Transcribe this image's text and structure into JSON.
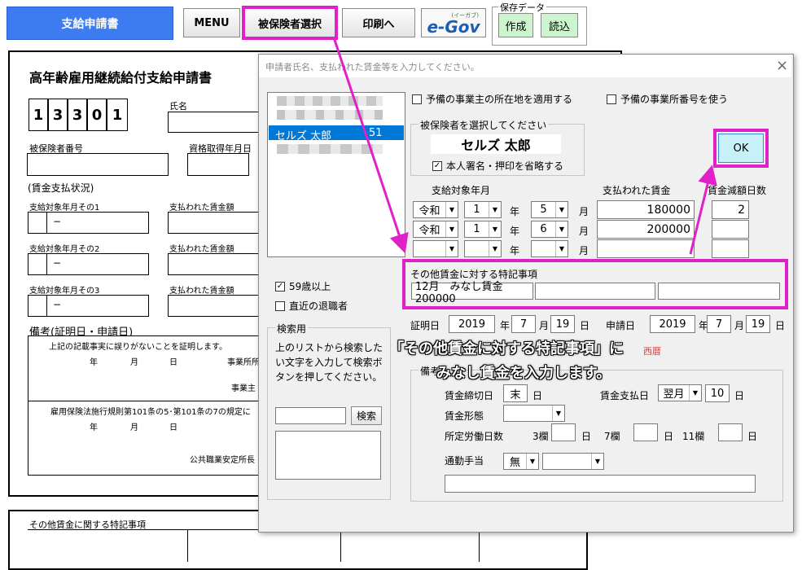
{
  "toolbar": {
    "title_button": "支給申請書",
    "menu": "MENU",
    "select_insured": "被保険者選択",
    "print": "印刷へ",
    "egov": "e-Gov",
    "egov_sub": "(イーガブ)",
    "save_group": "保存データ",
    "create": "作成",
    "load": "読込"
  },
  "form": {
    "title": "高年齢雇用継続給付支給申請書",
    "office_digits": [
      "1",
      "3",
      "3",
      "0",
      "1"
    ],
    "name_label": "氏名",
    "insured_no_label": "被保険者番号",
    "qual_date_label": "資格取得年月日",
    "wage_status": "(賃金支払状況)",
    "ym1": "支給対象年月その1",
    "ym2": "支給対象年月その2",
    "ym3": "支給対象年月その3",
    "wage_label": "支払われた賃金額",
    "dash": "−",
    "remarks": "備考(証明日・申請日)",
    "certify_line": "上記の記載事実に誤りがないことを証明します。",
    "year": "年",
    "month": "月",
    "day": "日",
    "office_loc": "事業所所",
    "employer": "事業主",
    "regulation": "雇用保険法施行規則第101条の5･第101条の7の規定に",
    "office_chief": "公共職業安定所長",
    "special_notes": "その他賃金に関する特記事項"
  },
  "dialog": {
    "title": "申請者氏名、支払われた賃金等を入力してください。",
    "close": "×",
    "list_selected_name": "セルズ 太郎",
    "list_selected_num": "51",
    "chk_spare_addr": "予備の事業主の所在地を適用する",
    "chk_spare_no": "予備の事業所番号を使う",
    "insured_group": "被保険者を選択してください",
    "insured_name": "セルズ 太郎",
    "chk_omit_seal": "本人署名・押印を省略する",
    "ok": "OK",
    "col_target_ym": "支給対象年月",
    "col_wage": "支払われた賃金",
    "col_reduce": "賃金減額日数",
    "rows": [
      {
        "era": "令和",
        "y": "1",
        "m": "5",
        "wage": "180000",
        "days": "2"
      },
      {
        "era": "令和",
        "y": "1",
        "m": "6",
        "wage": "200000",
        "days": ""
      },
      {
        "era": "",
        "y": "",
        "m": "",
        "wage": "",
        "days": ""
      }
    ],
    "nen": "年",
    "gatsu": "月",
    "other_wage_label": "その他賃金に対する特記事項",
    "other_wage_value": "12月　みなし賃金200000",
    "chk_59": "59歳以上",
    "chk_retired": "直近の退職者",
    "search_group": "検索用",
    "search_help": "上のリストから検索したい文字を入力して検索ボタンを押してください。",
    "search_button": "検索",
    "cert_date_label": "証明日",
    "cert_y": "2019",
    "cert_m": "7",
    "cert_d": "19",
    "apply_date_label": "申請日",
    "apply_y": "2019",
    "apply_m": "7",
    "apply_d": "19",
    "remark_group": "備考",
    "close_day_label": "賃金締切日",
    "close_day": "末",
    "pay_day_label": "賃金支払日",
    "pay_month": "翌月",
    "pay_day": "10",
    "wage_form_label": "賃金形態",
    "work_days_label": "所定労働日数",
    "col3": "3欄",
    "col7": "7欄",
    "col11": "11欄",
    "commute_label": "通勤手当",
    "commute_val": "無",
    "hint_era": "西暦"
  },
  "callout": {
    "line1": "「その他賃金に対する特記事項」に",
    "line2": "みなし賃金を入力します。"
  },
  "colors": {
    "accent": "#e020c8",
    "ok_bg": "#c8f0f8",
    "create_bg": "#cdf5cd",
    "title_btn": "#3d7bf0"
  }
}
